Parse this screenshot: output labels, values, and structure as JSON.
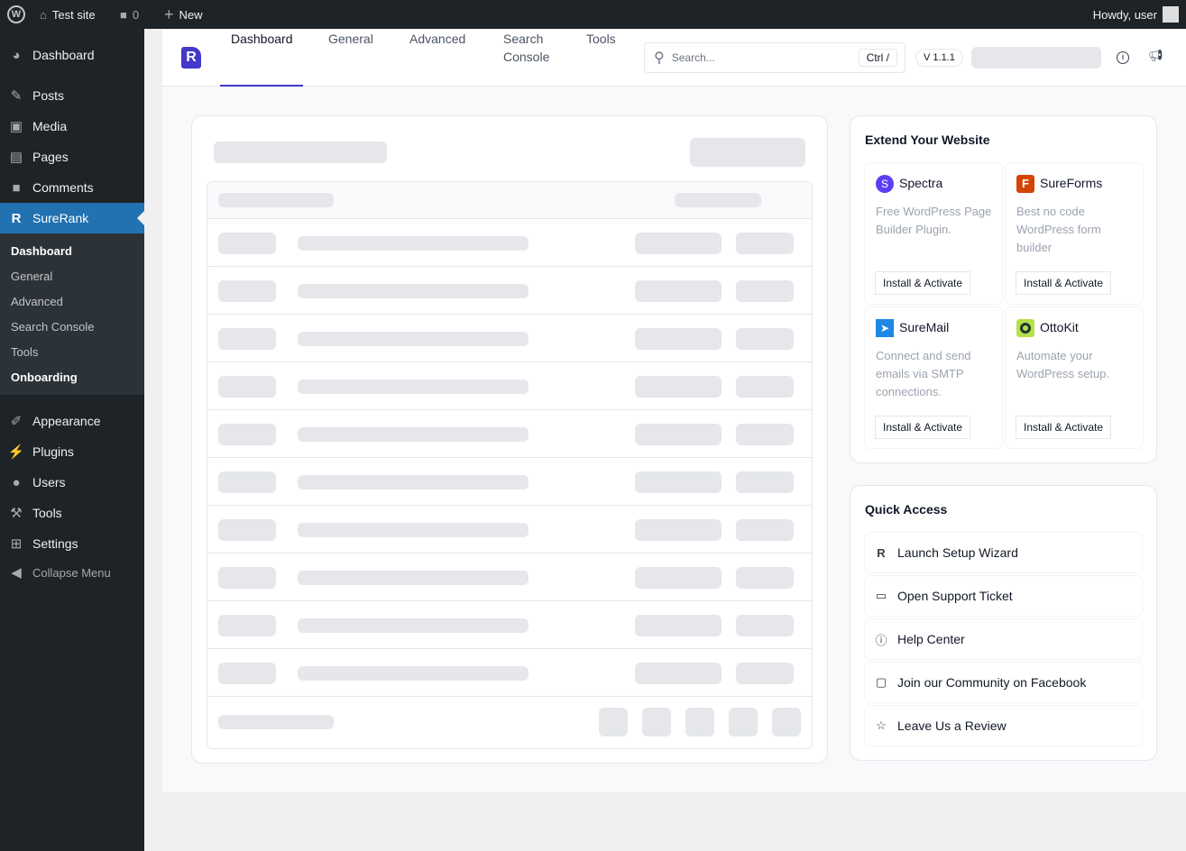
{
  "adminbar": {
    "site": "Test site",
    "comments": "0",
    "new": "New",
    "howdy": "Howdy, user"
  },
  "sidebar": {
    "items": [
      {
        "label": "Dashboard",
        "icon": "dashboard-icon"
      },
      {
        "label": "Posts",
        "icon": "pin-icon"
      },
      {
        "label": "Media",
        "icon": "media-icon"
      },
      {
        "label": "Pages",
        "icon": "pages-icon"
      },
      {
        "label": "Comments",
        "icon": "comment-icon"
      },
      {
        "label": "SureRank",
        "icon": "surerank-icon"
      },
      {
        "label": "Appearance",
        "icon": "brush-icon"
      },
      {
        "label": "Plugins",
        "icon": "plug-icon"
      },
      {
        "label": "Users",
        "icon": "user-icon"
      },
      {
        "label": "Tools",
        "icon": "wrench-icon"
      },
      {
        "label": "Settings",
        "icon": "settings-icon"
      },
      {
        "label": "Collapse Menu",
        "icon": "collapse-icon"
      }
    ],
    "submenu": [
      "Dashboard",
      "General",
      "Advanced",
      "Search Console",
      "Tools",
      "Onboarding"
    ]
  },
  "topnav": {
    "tabs": [
      "Dashboard",
      "General",
      "Advanced",
      "Search Console",
      "Tools"
    ],
    "search_placeholder": "Search...",
    "shortcut": "Ctrl /",
    "version": "V 1.1.1"
  },
  "extend": {
    "title": "Extend Your Website",
    "plugins": [
      {
        "name": "Spectra",
        "desc": "Free WordPress Page Builder Plugin.",
        "button": "Install & Activate",
        "color": "#5b3ff5"
      },
      {
        "name": "SureForms",
        "desc": "Best no code WordPress form builder",
        "button": "Install & Activate",
        "color": "#d54407"
      },
      {
        "name": "SureMail",
        "desc": "Connect and send emails via SMTP connections.",
        "button": "Install & Activate",
        "color": "#1e88e5"
      },
      {
        "name": "OttoKit",
        "desc": "Automate your WordPress setup.",
        "button": "Install & Activate",
        "color": "#b8e04a"
      }
    ]
  },
  "quick": {
    "title": "Quick Access",
    "items": [
      "Launch Setup Wizard",
      "Open Support Ticket",
      "Help Center",
      "Join our Community on Facebook",
      "Leave Us a Review"
    ]
  }
}
